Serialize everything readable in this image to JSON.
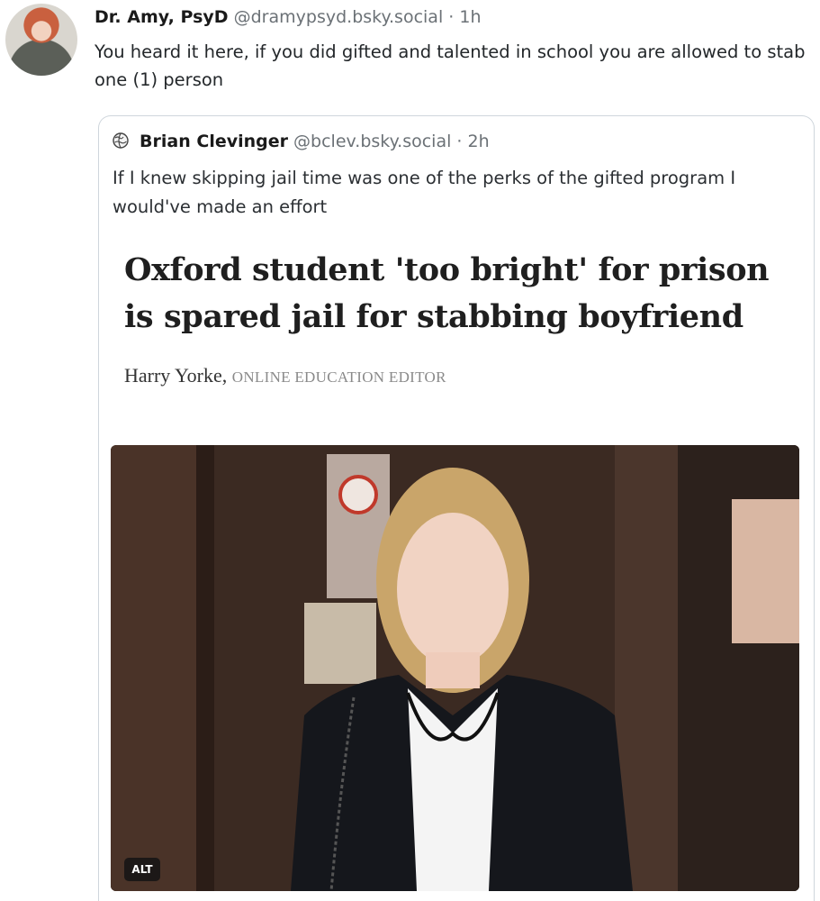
{
  "post": {
    "author": "Dr. Amy, PsyD",
    "handle": "@dramypsyd.bsky.social",
    "separator": "·",
    "time": "1h",
    "text": "You heard it here, if you did gifted and talented in school you are allowed to stab one (1) person"
  },
  "quote": {
    "author": "Brian Clevinger",
    "handle": "@bclev.bsky.social",
    "separator": "·",
    "time": "2h",
    "text": "If I knew skipping jail time was one of the perks of the gifted program I would've made an effort",
    "article": {
      "headline": "Oxford student 'too bright' for prison is spared jail for stabbing boyfriend",
      "byline_name": "Harry Yorke,",
      "byline_role": "ONLINE EDUCATION EDITOR"
    },
    "image": {
      "alt_badge": "ALT"
    }
  },
  "icons": {
    "quote_avatar": "globe-icon"
  }
}
